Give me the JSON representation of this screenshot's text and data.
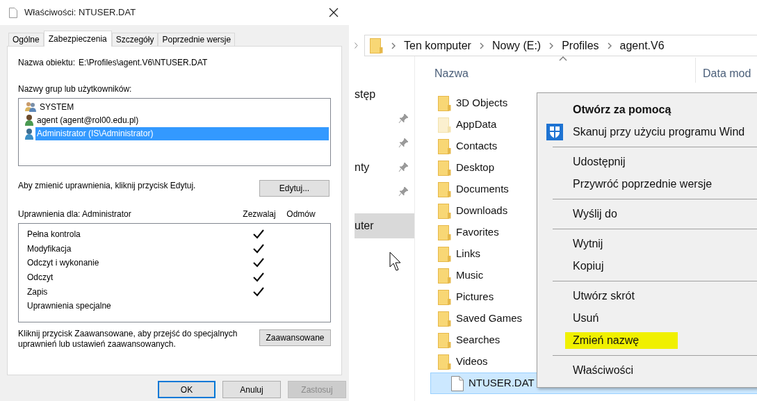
{
  "dialog": {
    "title": "Właściwości: NTUSER.DAT",
    "tabs": [
      {
        "label": "Ogólne",
        "selected": false
      },
      {
        "label": "Zabezpieczenia",
        "selected": true
      },
      {
        "label": "Szczegóły",
        "selected": false
      },
      {
        "label": "Poprzednie wersje",
        "selected": false
      }
    ],
    "object_name_label": "Nazwa obiektu:",
    "object_name_value": "E:\\Profiles\\agent.V6\\NTUSER.DAT",
    "groups_label": "Nazwy grup lub użytkowników:",
    "principals": [
      {
        "name": "SYSTEM",
        "kind": "group",
        "selected": false
      },
      {
        "name": "agent (agent@rol00.edu.pl)",
        "kind": "user",
        "selected": false
      },
      {
        "name": "Administrator (IS\\Administrator)",
        "kind": "admin",
        "selected": true
      }
    ],
    "edit_hint": "Aby zmienić uprawnienia, kliknij przycisk Edytuj.",
    "edit_button": "Edytuj...",
    "permissions_label": "Uprawnienia dla: Administrator",
    "columns": [
      "Zezwalaj",
      "Odmów"
    ],
    "permissions": [
      {
        "name": "Pełna kontrola",
        "allow": true
      },
      {
        "name": "Modyfikacja",
        "allow": true
      },
      {
        "name": "Odczyt i wykonanie",
        "allow": true
      },
      {
        "name": "Odczyt",
        "allow": true
      },
      {
        "name": "Zapis",
        "allow": true
      },
      {
        "name": "Uprawnienia specjalne",
        "allow": false
      }
    ],
    "advanced_hint": "Kliknij przycisk Zaawansowane, aby przejść do specjalnych uprawnień lub ustawień zaawansowanych.",
    "advanced_button": "Zaawansowane",
    "buttons": [
      {
        "label": "OK",
        "kind": "default"
      },
      {
        "label": "Anuluj",
        "kind": "normal"
      },
      {
        "label": "Zastosuj",
        "kind": "disabled"
      }
    ]
  },
  "explorer": {
    "breadcrumb": [
      "Ten komputer",
      "Nowy (E:)",
      "Profiles",
      "agent.V6"
    ],
    "nav_items": [
      {
        "label": "stęp",
        "pinned": false,
        "selected": false
      },
      {
        "pinned": true,
        "selected": false
      },
      {
        "pinned": true,
        "selected": false
      },
      {
        "label": "nty",
        "pinned": true,
        "selected": false
      },
      {
        "pinned": true,
        "selected": false
      },
      {
        "label": "uter",
        "pinned": false,
        "selected": true
      }
    ],
    "columns": [
      "Nazwa",
      "Data mod"
    ],
    "files": [
      {
        "name": "3D Objects",
        "kind": "folder",
        "selected": false
      },
      {
        "name": "AppData",
        "kind": "hidden_folder",
        "selected": false
      },
      {
        "name": "Contacts",
        "kind": "folder",
        "selected": false
      },
      {
        "name": "Desktop",
        "kind": "folder",
        "selected": false
      },
      {
        "name": "Documents",
        "kind": "folder",
        "selected": false
      },
      {
        "name": "Downloads",
        "kind": "folder",
        "selected": false
      },
      {
        "name": "Favorites",
        "kind": "folder",
        "selected": false
      },
      {
        "name": "Links",
        "kind": "folder",
        "selected": false
      },
      {
        "name": "Music",
        "kind": "folder",
        "selected": false
      },
      {
        "name": "Pictures",
        "kind": "folder",
        "selected": false
      },
      {
        "name": "Saved Games",
        "kind": "folder",
        "selected": false
      },
      {
        "name": "Searches",
        "kind": "folder",
        "selected": false
      },
      {
        "name": "Videos",
        "kind": "folder",
        "selected": false
      },
      {
        "name": "NTUSER.DAT",
        "kind": "file",
        "selected": true
      }
    ],
    "context_menu": [
      {
        "kind": "default",
        "label": "Otwórz za pomocą"
      },
      {
        "kind": "shield",
        "label": "Skanuj przy użyciu programu Wind"
      },
      {
        "kind": "separator"
      },
      {
        "kind": "item",
        "label": "Udostępnij"
      },
      {
        "kind": "item",
        "label": "Przywróć poprzednie wersje"
      },
      {
        "kind": "separator"
      },
      {
        "kind": "item",
        "label": "Wyślij do"
      },
      {
        "kind": "separator"
      },
      {
        "kind": "item",
        "label": "Wytnij"
      },
      {
        "kind": "item",
        "label": "Kopiuj"
      },
      {
        "kind": "separator"
      },
      {
        "kind": "item",
        "label": "Utwórz skrót"
      },
      {
        "kind": "item",
        "label": "Usuń"
      },
      {
        "kind": "item",
        "label": "Zmień nazwę",
        "highlighted": true
      },
      {
        "kind": "separator"
      },
      {
        "kind": "item",
        "label": "Właściwości"
      }
    ]
  }
}
